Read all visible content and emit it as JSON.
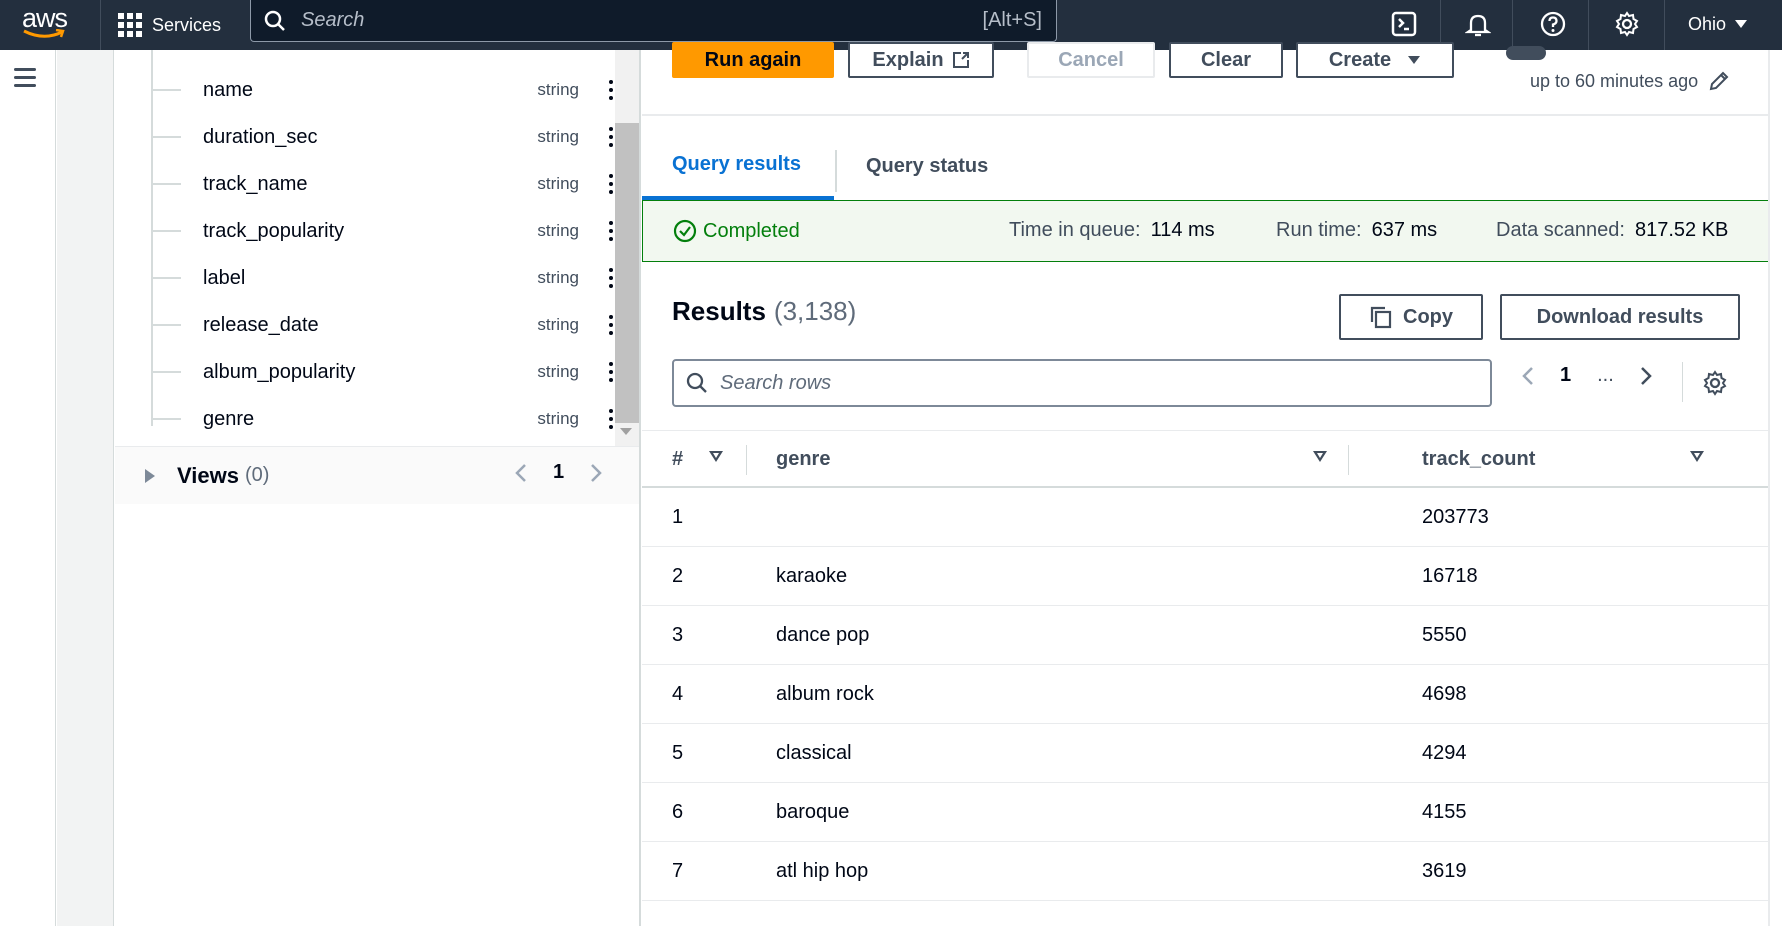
{
  "topbar": {
    "logo_text": "aws",
    "services_label": "Services",
    "search_placeholder": "Search",
    "search_shortcut": "[Alt+S]",
    "region": "Ohio"
  },
  "schema": {
    "fields": [
      {
        "name": "name",
        "type": "string"
      },
      {
        "name": "duration_sec",
        "type": "string"
      },
      {
        "name": "track_name",
        "type": "string"
      },
      {
        "name": "track_popularity",
        "type": "string"
      },
      {
        "name": "label",
        "type": "string"
      },
      {
        "name": "release_date",
        "type": "string"
      },
      {
        "name": "album_popularity",
        "type": "string"
      },
      {
        "name": "genre",
        "type": "string"
      }
    ],
    "views_label": "Views",
    "views_count": "(0)",
    "views_page": "1"
  },
  "toolbar": {
    "run_again": "Run again",
    "explain": "Explain",
    "cancel": "Cancel",
    "clear": "Clear",
    "create": "Create",
    "reuse_sub": "up to 60 minutes ago"
  },
  "tabs": {
    "results": "Query results",
    "status": "Query status"
  },
  "status": {
    "state": "Completed",
    "queue_label": "Time in queue:",
    "queue_value": "114 ms",
    "run_label": "Run time:",
    "run_value": "637 ms",
    "scanned_label": "Data scanned:",
    "scanned_value": "817.52 KB",
    "color": "#037f0c"
  },
  "results": {
    "title": "Results",
    "count": "(3,138)",
    "copy_label": "Copy",
    "download_label": "Download results",
    "search_placeholder": "Search rows",
    "page": "1",
    "ellipsis": "..."
  },
  "table": {
    "columns": [
      "#",
      "genre",
      "track_count"
    ],
    "rows": [
      {
        "num": "1",
        "genre": "",
        "count": "203773"
      },
      {
        "num": "2",
        "genre": "karaoke",
        "count": "16718"
      },
      {
        "num": "3",
        "genre": "dance pop",
        "count": "5550"
      },
      {
        "num": "4",
        "genre": "album rock",
        "count": "4698"
      },
      {
        "num": "5",
        "genre": "classical",
        "count": "4294"
      },
      {
        "num": "6",
        "genre": "baroque",
        "count": "4155"
      },
      {
        "num": "7",
        "genre": "atl hip hop",
        "count": "3619"
      }
    ]
  },
  "colors": {
    "accent": "#0972d3",
    "primary_button": "#ff9900",
    "topbar": "#232f3e"
  }
}
